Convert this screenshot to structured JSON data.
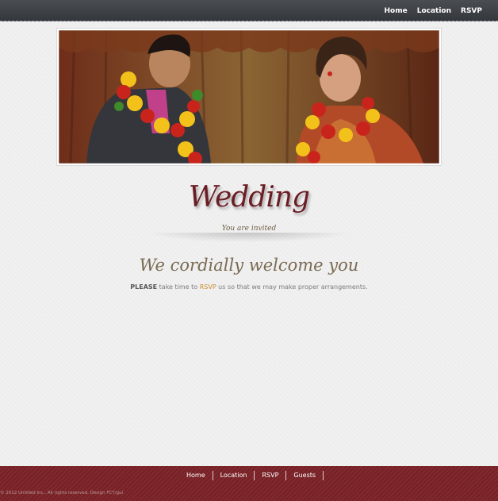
{
  "header": {
    "nav": [
      "Home",
      "Location",
      "RSVP"
    ]
  },
  "hero": {
    "image_label": "wedding-photo"
  },
  "main": {
    "title": "Wedding",
    "subtitle": "You are invited",
    "welcome": "We cordially welcome you",
    "note_please": "PLEASE",
    "note_before": " take time to ",
    "note_rsvp": "RSVP",
    "note_after": " us so that we may make proper arrangements."
  },
  "footer": {
    "nav": [
      "Home",
      "Location",
      "RSVP",
      "Guests"
    ],
    "copyright": "© 2012 Untitled Inc.. All rights reserved. Design FCT/gui"
  },
  "colors": {
    "topbar": "#3f4247",
    "footer": "#7c2328",
    "title": "#6b1d24",
    "accent": "#cc8a2e"
  }
}
